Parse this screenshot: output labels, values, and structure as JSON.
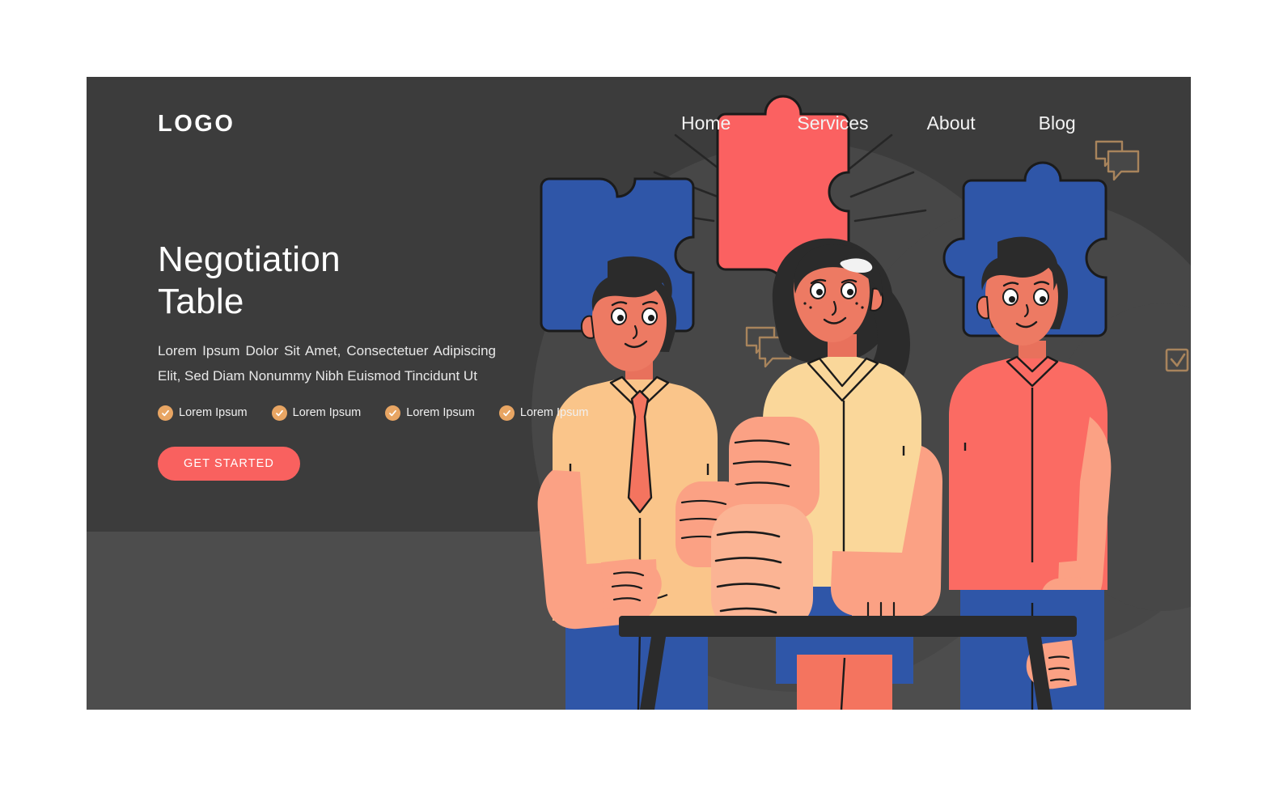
{
  "header": {
    "logo": "LOGO",
    "nav": [
      {
        "label": "Home",
        "name": "nav-item-home"
      },
      {
        "label": "Services",
        "name": "nav-item-services"
      },
      {
        "label": "About",
        "name": "nav-item-about"
      },
      {
        "label": "Blog",
        "name": "nav-item-blog"
      }
    ]
  },
  "hero": {
    "title": "Negotiation\nTable",
    "subtitle": "Lorem Ipsum Dolor Sit Amet, Consectetuer Adipiscing Elit, Sed Diam Nonummy Nibh Euismod Tincidunt Ut",
    "features": [
      {
        "label": "Lorem Ipsum",
        "icon": "check-circle-icon"
      },
      {
        "label": "Lorem Ipsum",
        "icon": "check-circle-icon"
      },
      {
        "label": "Lorem Ipsum",
        "icon": "check-circle-icon"
      },
      {
        "label": "Lorem Ipsum",
        "icon": "check-circle-icon"
      }
    ],
    "cta_label": "GET STARTED"
  },
  "illustration": {
    "name": "negotiation-team-illustration",
    "description": "Three business people standing behind a dark table joining fists, with three jigsaw puzzle pieces floating above",
    "puzzle_pieces": [
      {
        "name": "puzzle-piece-left",
        "color": "#2f56a8"
      },
      {
        "name": "puzzle-piece-center",
        "color": "#fb6161"
      },
      {
        "name": "puzzle-piece-right",
        "color": "#2f56a8"
      }
    ],
    "people": [
      {
        "name": "person-left-man",
        "shirt": "#fac58a",
        "tie": "#f4745f",
        "pants": "#2f56a8"
      },
      {
        "name": "person-center-woman",
        "top": "#fad79a",
        "skirt": "#2f56a8",
        "under": "#f4745f"
      },
      {
        "name": "person-right-man",
        "shirt": "#fb6b63",
        "pants": "#2f56a8"
      }
    ],
    "decor_icons": [
      {
        "name": "checkbox-icon",
        "color": "#a8845c"
      },
      {
        "name": "speech-bubbles-icon",
        "color": "#a8845c"
      }
    ]
  },
  "colors": {
    "page_background": "#ffffff",
    "frame_background": "#4d4d4d",
    "panel_background": "#3c3c3c",
    "accent_red": "#f9615f",
    "accent_blue": "#2f56a8",
    "accent_tan": "#e8a563",
    "text_primary": "#ffffff",
    "text_secondary": "#e8e8e8"
  }
}
